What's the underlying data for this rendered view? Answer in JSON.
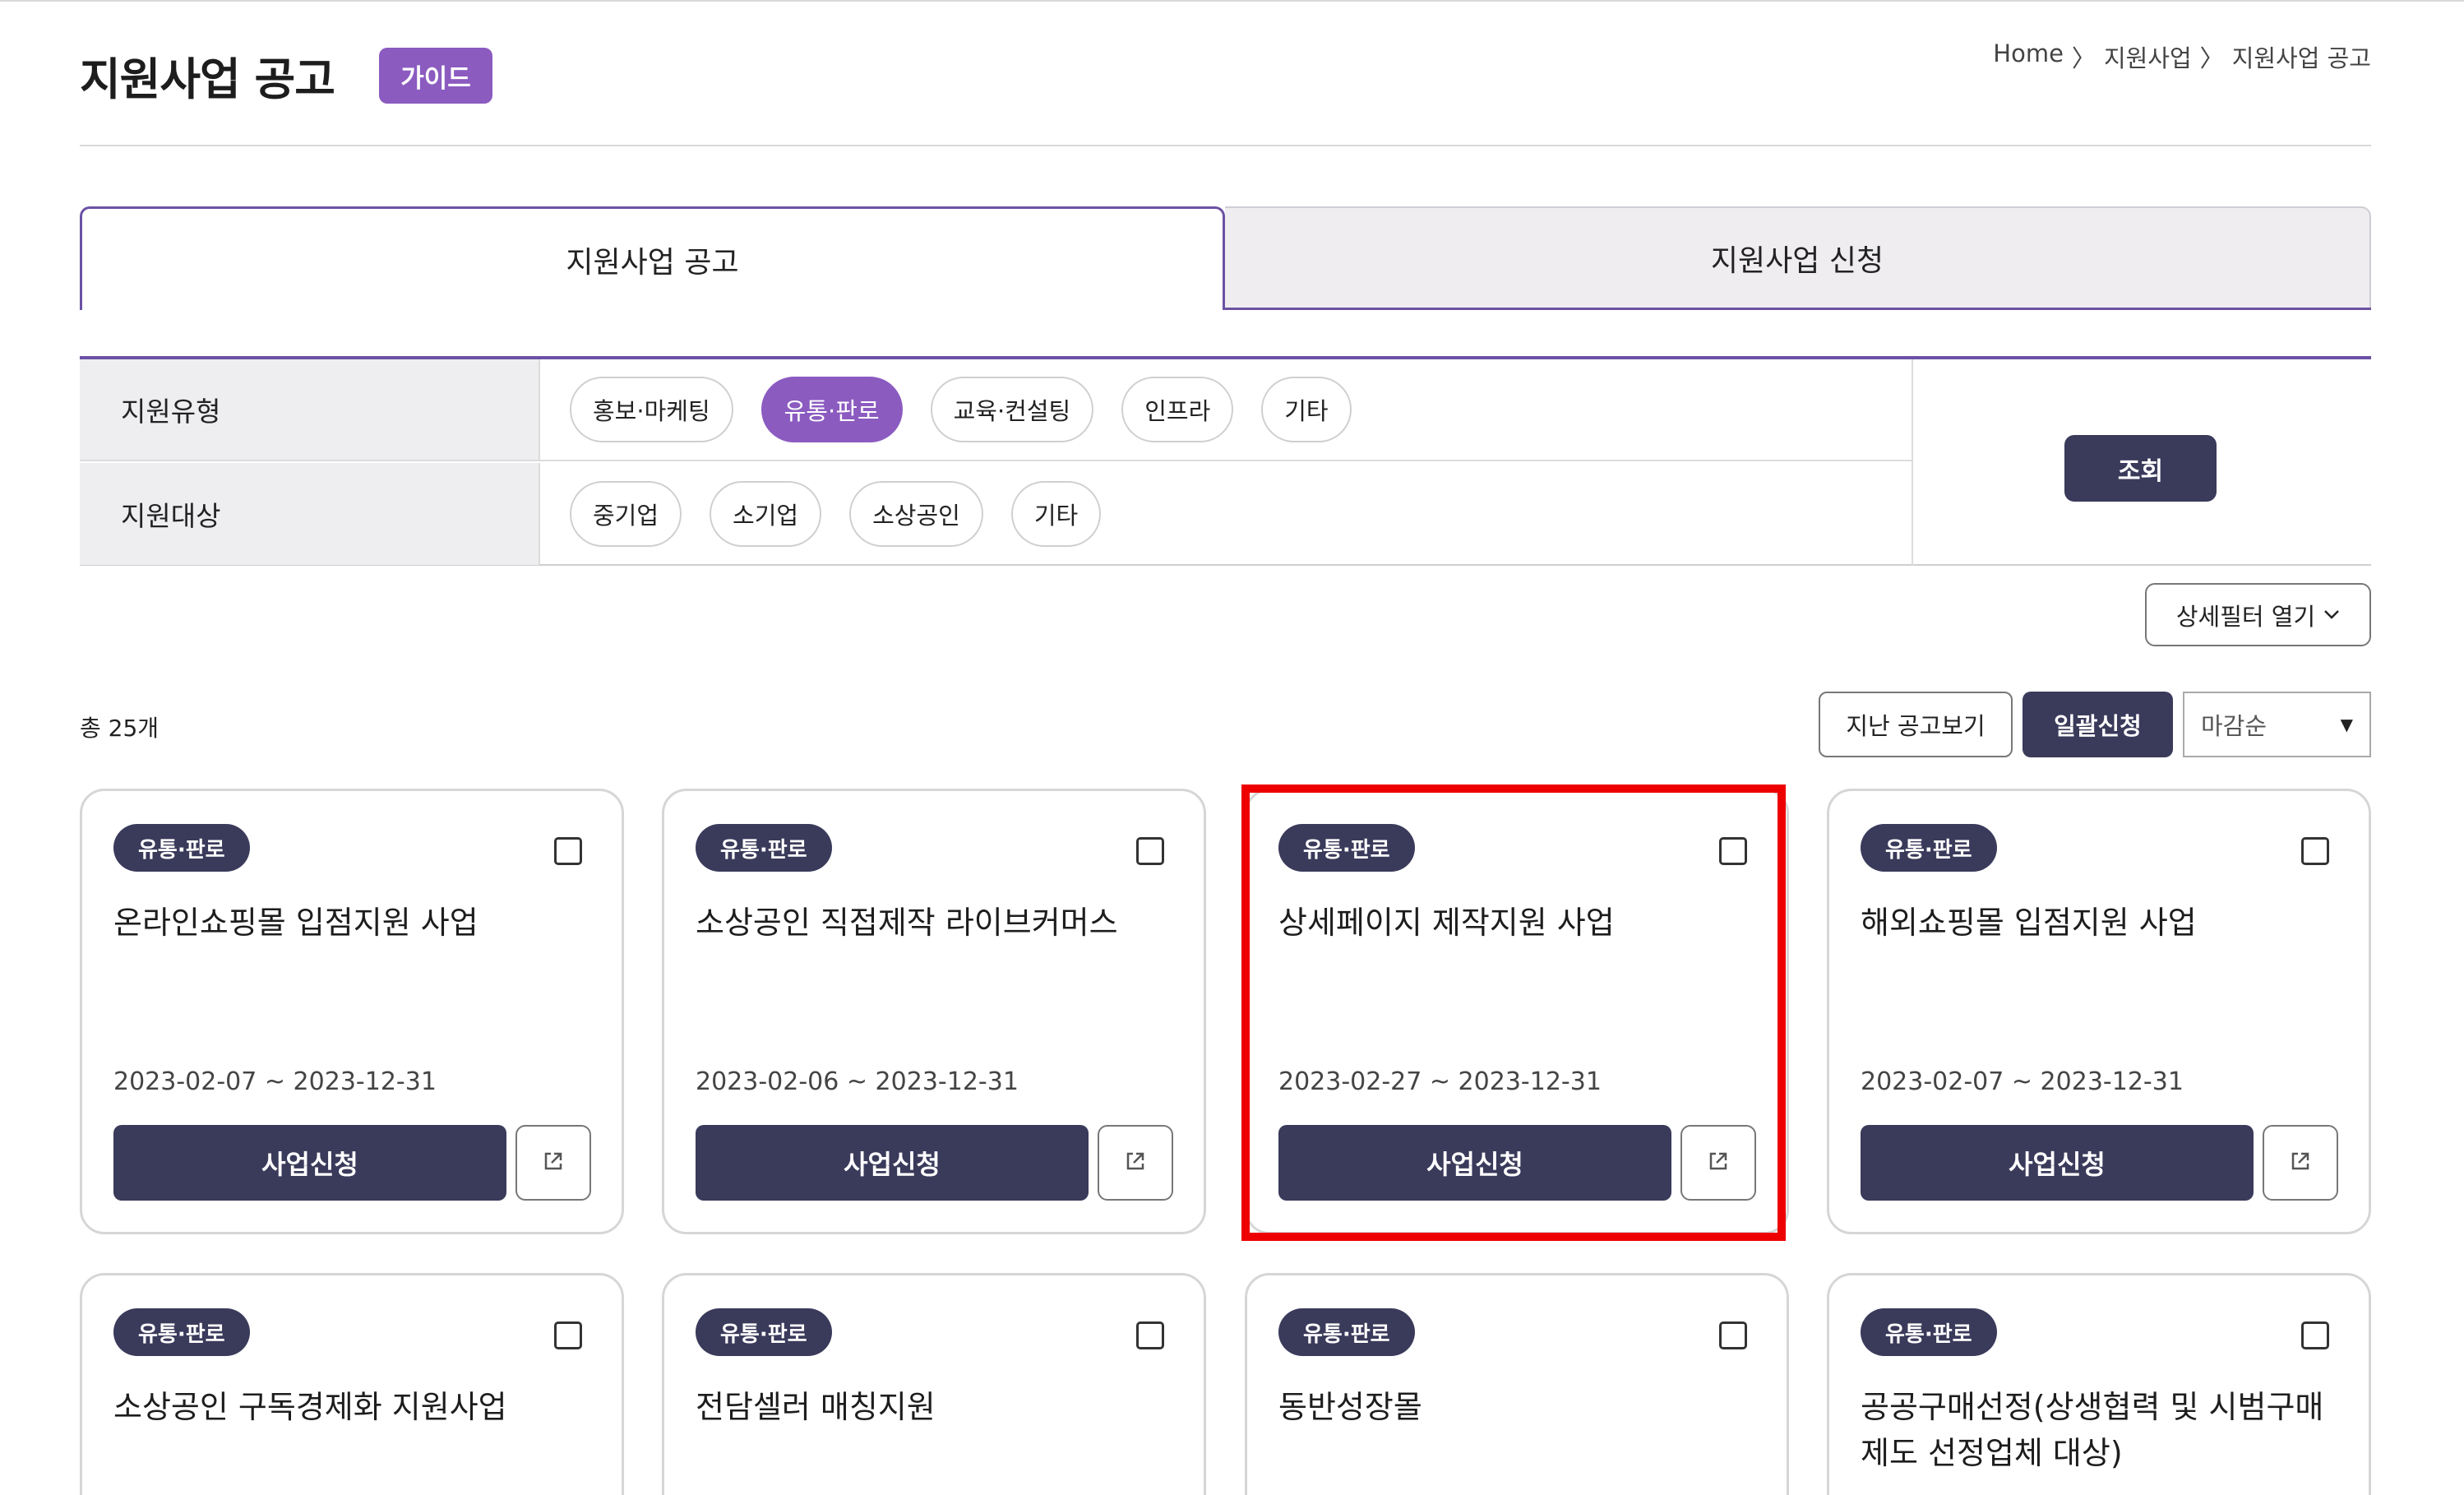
{
  "header": {
    "title": "지원사업 공고",
    "guide_label": "가이드",
    "breadcrumb": [
      "Home",
      "지원사업",
      "지원사업 공고"
    ],
    "breadcrumb_sep": "〉"
  },
  "tabs": [
    {
      "label": "지원사업 공고",
      "active": true
    },
    {
      "label": "지원사업 신청",
      "active": false
    }
  ],
  "filters": {
    "support_type": {
      "label": "지원유형",
      "options": [
        "홍보·마케팅",
        "유통·판로",
        "교육·컨설팅",
        "인프라",
        "기타"
      ],
      "selected": "유통·판로"
    },
    "support_target": {
      "label": "지원대상",
      "options": [
        "중기업",
        "소기업",
        "소상공인",
        "기타"
      ]
    },
    "search_label": "조회",
    "detail_filter_label": "상세필터 열기"
  },
  "toolbar": {
    "total": "총 25개",
    "past_label": "지난 공고보기",
    "bulk_label": "일괄신청",
    "sort_selected": "마감순"
  },
  "cards": [
    {
      "badge": "유통·판로",
      "title": "온라인쇼핑몰 입점지원 사업",
      "date": "2023-02-07 ~ 2023-12-31",
      "apply_label": "사업신청"
    },
    {
      "badge": "유통·판로",
      "title": "소상공인 직접제작 라이브커머스",
      "date": "2023-02-06 ~ 2023-12-31",
      "apply_label": "사업신청"
    },
    {
      "badge": "유통·판로",
      "title": "상세페이지 제작지원 사업",
      "date": "2023-02-27 ~ 2023-12-31",
      "apply_label": "사업신청"
    },
    {
      "badge": "유통·판로",
      "title": "해외쇼핑몰 입점지원 사업",
      "date": "2023-02-07 ~ 2023-12-31",
      "apply_label": "사업신청"
    },
    {
      "badge": "유통·판로",
      "title": "소상공인 구독경제화 지원사업"
    },
    {
      "badge": "유통·판로",
      "title": "전담셀러 매칭지원"
    },
    {
      "badge": "유통·판로",
      "title": "동반성장몰"
    },
    {
      "badge": "유통·판로",
      "title": "공공구매선정(상생협력 및 시범구매제도 선정업체 대상)"
    }
  ],
  "icons": {
    "external_link": "external-link-icon",
    "chevron_down": "chevron-down-icon",
    "caret_down": "caret-down-icon",
    "checkbox": "checkbox-icon"
  },
  "colors": {
    "accent_purple": "#8b5bc0",
    "tab_border": "#6b52a3",
    "dark_navy": "#3a3a5b",
    "highlight_red": "#ee0000"
  }
}
